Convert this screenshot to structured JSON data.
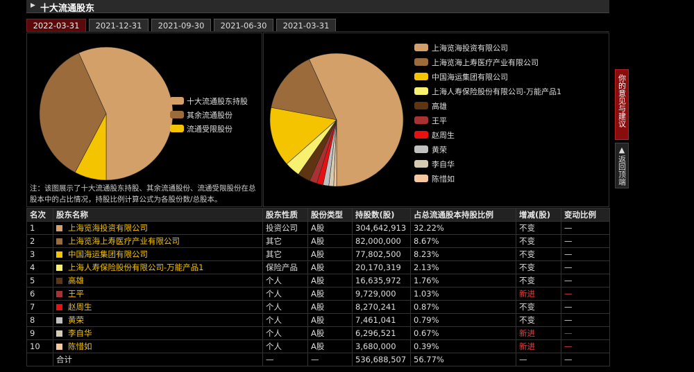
{
  "section": {
    "title": "十大流通股东"
  },
  "tabs": [
    {
      "label": "2022-03-31",
      "active": true
    },
    {
      "label": "2021-12-31",
      "active": false
    },
    {
      "label": "2021-09-30",
      "active": false
    },
    {
      "label": "2021-06-30",
      "active": false
    },
    {
      "label": "2021-03-31",
      "active": false
    }
  ],
  "left_chart": {
    "legend": [
      "十大流通股东持股",
      "其余流通股份",
      "流通受限股份"
    ],
    "colors": [
      "#d4a06a",
      "#9b6b3c",
      "#f5c400"
    ],
    "shares_pct": [
      56.77,
      35.5,
      7.73
    ]
  },
  "note": "注：该图展示了十大流通股东持股、其余流通股份、流通受限股份在总股本中的占比情况，持股比例计算公式为各股份数/总股本。",
  "right_chart": {
    "legend": [
      "上海览海投资有限公司",
      "上海览海上寿医疗产业有限公司",
      "中国海运集团有限公司",
      "上海人寿保险股份有限公司-万能产品1",
      "高雄",
      "王平",
      "赵周生",
      "黄荣",
      "李自华",
      "陈惜如"
    ],
    "colors": [
      "#d4a06a",
      "#9b6b3c",
      "#f5c400",
      "#f8f070",
      "#5e3510",
      "#a83232",
      "#e81010",
      "#c0c0c0",
      "#d6cbb0",
      "#f5c8a0"
    ],
    "values": [
      32.22,
      8.67,
      8.23,
      2.13,
      1.76,
      1.03,
      0.87,
      0.79,
      0.67,
      0.39
    ]
  },
  "table": {
    "headers": [
      "名次",
      "股东名称",
      "股东性质",
      "股份类型",
      "持股数(股)",
      "占总流通股本持股比例",
      "增减(股)",
      "变动比例"
    ],
    "rows": [
      {
        "rank": "1",
        "name": "上海览海投资有限公司",
        "nature": "投资公司",
        "type": "A股",
        "shares": "304,642,913",
        "ratio": "32.22%",
        "change": "不变",
        "change_new": false,
        "pct": "—",
        "pct_red": false
      },
      {
        "rank": "2",
        "name": "上海览海上寿医疗产业有限公司",
        "nature": "其它",
        "type": "A股",
        "shares": "82,000,000",
        "ratio": "8.67%",
        "change": "不变",
        "change_new": false,
        "pct": "—",
        "pct_red": false
      },
      {
        "rank": "3",
        "name": "中国海运集团有限公司",
        "nature": "其它",
        "type": "A股",
        "shares": "77,802,500",
        "ratio": "8.23%",
        "change": "不变",
        "change_new": false,
        "pct": "—",
        "pct_red": false
      },
      {
        "rank": "4",
        "name": "上海人寿保险股份有限公司-万能产品1",
        "nature": "保险产品",
        "type": "A股",
        "shares": "20,170,319",
        "ratio": "2.13%",
        "change": "不变",
        "change_new": false,
        "pct": "—",
        "pct_red": false
      },
      {
        "rank": "5",
        "name": "高雄",
        "nature": "个人",
        "type": "A股",
        "shares": "16,635,972",
        "ratio": "1.76%",
        "change": "不变",
        "change_new": false,
        "pct": "—",
        "pct_red": false
      },
      {
        "rank": "6",
        "name": "王平",
        "nature": "个人",
        "type": "A股",
        "shares": "9,729,000",
        "ratio": "1.03%",
        "change": "新进",
        "change_new": true,
        "pct": "—",
        "pct_red": true
      },
      {
        "rank": "7",
        "name": "赵周生",
        "nature": "个人",
        "type": "A股",
        "shares": "8,270,241",
        "ratio": "0.87%",
        "change": "不变",
        "change_new": false,
        "pct": "—",
        "pct_red": false
      },
      {
        "rank": "8",
        "name": "黄荣",
        "nature": "个人",
        "type": "A股",
        "shares": "7,461,041",
        "ratio": "0.79%",
        "change": "不变",
        "change_new": false,
        "pct": "—",
        "pct_red": false
      },
      {
        "rank": "9",
        "name": "李自华",
        "nature": "个人",
        "type": "A股",
        "shares": "6,296,521",
        "ratio": "0.67%",
        "change": "新进",
        "change_new": true,
        "pct": "—",
        "pct_red": true
      },
      {
        "rank": "10",
        "name": "陈惜如",
        "nature": "个人",
        "type": "A股",
        "shares": "3,680,000",
        "ratio": "0.39%",
        "change": "新进",
        "change_new": true,
        "pct": "—",
        "pct_red": true
      }
    ],
    "total": {
      "label": "合计",
      "nature": "—",
      "type": "—",
      "shares": "536,688,507",
      "ratio": "56.77%",
      "change": "—",
      "pct": "—"
    }
  },
  "side": {
    "feedback": "你的意见与建议",
    "top": "返回顶端"
  }
}
